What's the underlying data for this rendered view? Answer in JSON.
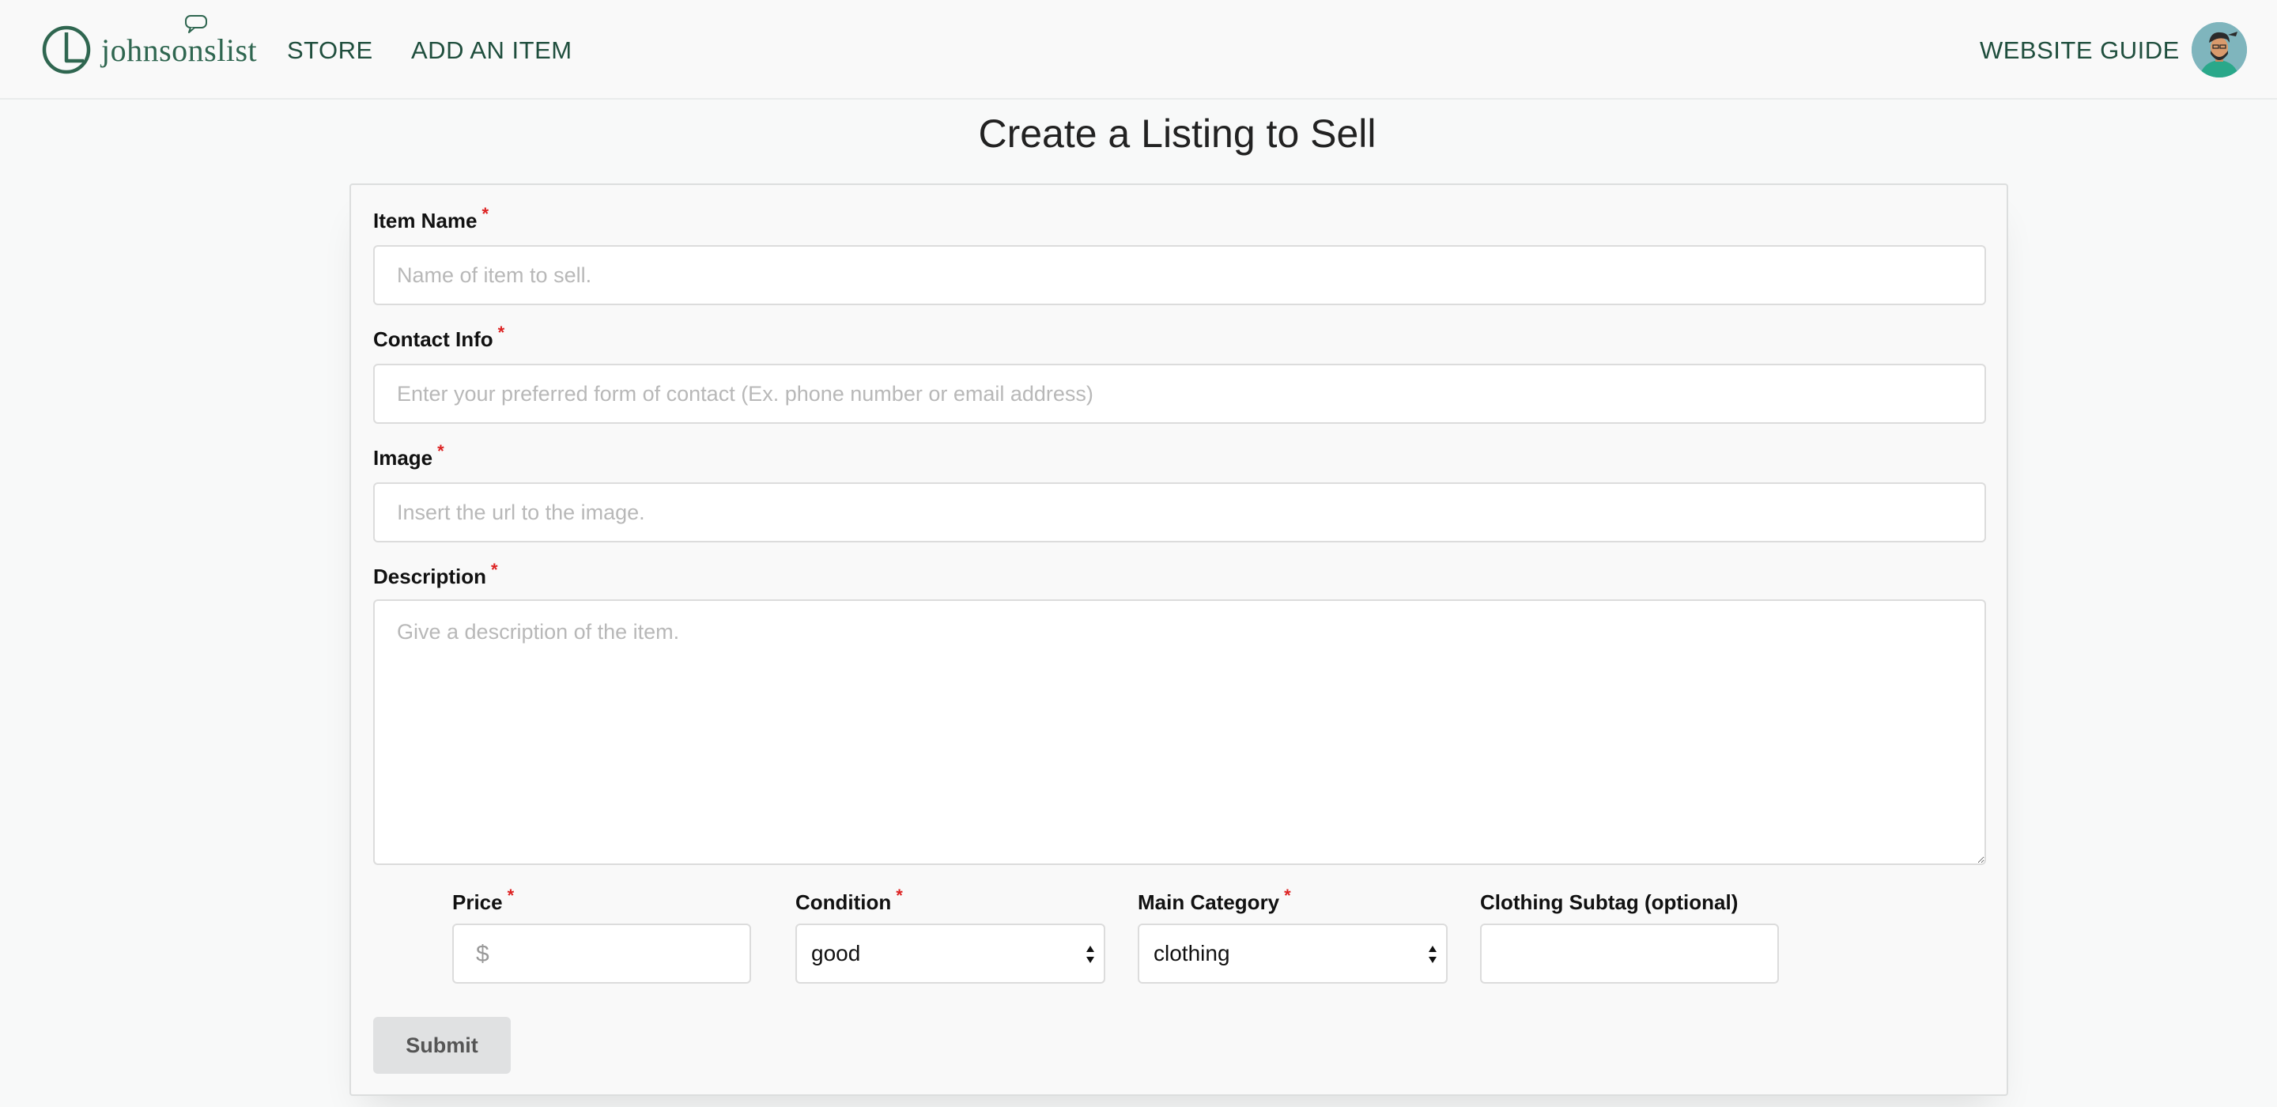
{
  "brand": {
    "name": "johnsonslist",
    "color": "#2f6650"
  },
  "nav": {
    "store": "STORE",
    "add_item": "ADD AN ITEM",
    "guide": "WEBSITE GUIDE"
  },
  "page": {
    "title": "Create a Listing to Sell"
  },
  "form": {
    "required_mark": "*",
    "item_name": {
      "label": "Item Name",
      "placeholder": "Name of item to sell."
    },
    "contact": {
      "label": "Contact Info",
      "placeholder": "Enter your preferred form of contact (Ex. phone number or email address)"
    },
    "image": {
      "label": "Image",
      "placeholder": "Insert the url to the image."
    },
    "description": {
      "label": "Description",
      "placeholder": "Give a description of the item."
    },
    "price": {
      "label": "Price",
      "symbol": "$"
    },
    "condition": {
      "label": "Condition",
      "value": "good"
    },
    "category": {
      "label": "Main Category",
      "value": "clothing"
    },
    "subtag": {
      "label": "Clothing Subtag (optional)"
    },
    "submit": "Submit"
  },
  "icons": {
    "logo": "johnsonslist-logo-icon",
    "avatar": "user-avatar",
    "select_arrows": "select-arrows-icon"
  }
}
